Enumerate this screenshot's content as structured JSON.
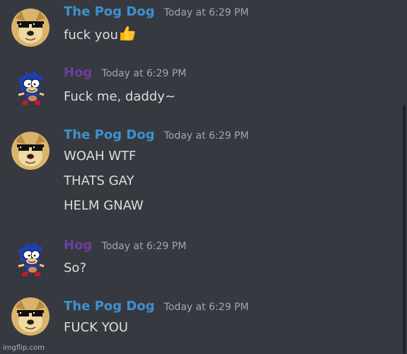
{
  "colors": {
    "background": "#36393f",
    "message_text": "#dcddde",
    "timestamp_text": "#a3a6aa"
  },
  "messages": [
    {
      "author": "The Pog Dog",
      "author_color": "#3d91cf",
      "avatar": "doge-avatar",
      "timestamp": "Today at 6:29 PM",
      "lines": [
        "fuck you"
      ],
      "emoji": "thumbs-up-icon"
    },
    {
      "author": "Hog",
      "author_color": "#6b3ea0",
      "avatar": "sanic-avatar",
      "timestamp": "Today at 6:29 PM",
      "lines": [
        "Fuck me, daddy~"
      ]
    },
    {
      "author": "The Pog Dog",
      "author_color": "#3d91cf",
      "avatar": "doge-avatar",
      "timestamp": "Today at 6:29 PM",
      "lines": [
        "WOAH WTF",
        "THATS GAY",
        "HELM GNAW"
      ]
    },
    {
      "author": "Hog",
      "author_color": "#6b3ea0",
      "avatar": "sanic-avatar",
      "timestamp": "Today at 6:29 PM",
      "lines": [
        "So?"
      ]
    },
    {
      "author": "The Pog Dog",
      "author_color": "#3d91cf",
      "avatar": "doge-avatar",
      "timestamp": "Today at 6:29 PM",
      "lines": [
        "FUCK YOU"
      ]
    }
  ],
  "watermark": "imgflip.com"
}
